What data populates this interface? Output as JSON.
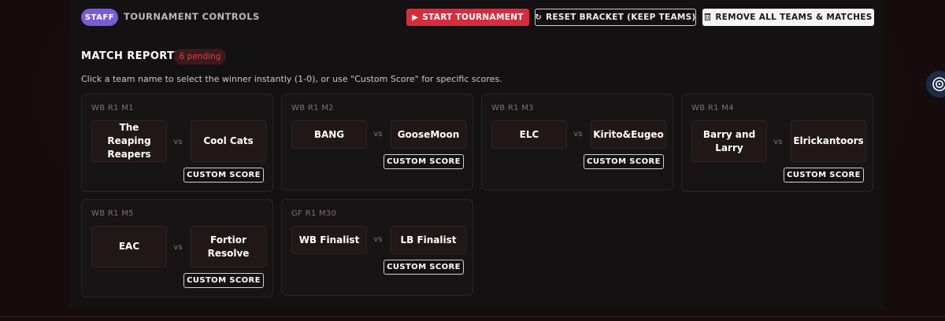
{
  "controls": {
    "staff_badge": "STAFF",
    "title": "TOURNAMENT CONTROLS",
    "start_button": "START TOURNAMENT",
    "reset_button": "RESET BRACKET (KEEP TEAMS)",
    "remove_button": "REMOVE ALL TEAMS & MATCHES",
    "start_icon": "play-icon",
    "reset_icon": "refresh-icon",
    "remove_icon": "trash-icon"
  },
  "reporting": {
    "title": "MATCH REPORTING",
    "pending_badge": "6 pending",
    "instructions": "Click a team name to select the winner instantly (1-0), or use \"Custom Score\" for specific scores."
  },
  "vs_text": "vs",
  "custom_score_label": "CUSTOM SCORE",
  "matches": [
    {
      "label": "WB R1 M1",
      "team1": "The Reaping Reapers",
      "team2": "Cool Cats"
    },
    {
      "label": "WB R1 M2",
      "team1": "BANG",
      "team2": "GooseMoon"
    },
    {
      "label": "WB R1 M3",
      "team1": "ELC",
      "team2": "Kirito&Eugeo"
    },
    {
      "label": "WB R1 M4",
      "team1": "Barry and Larry",
      "team2": "Elrickantoors"
    },
    {
      "label": "WB R1 M5",
      "team1": "EAC",
      "team2": "Fortior Resolve"
    },
    {
      "label": "GF R1 M30",
      "team1": "WB Finalist",
      "team2": "LB Finalist"
    }
  ],
  "colors": {
    "accent_red": "#d62d3e",
    "staff_purple": "#7b5ad6",
    "background": "#141112"
  }
}
